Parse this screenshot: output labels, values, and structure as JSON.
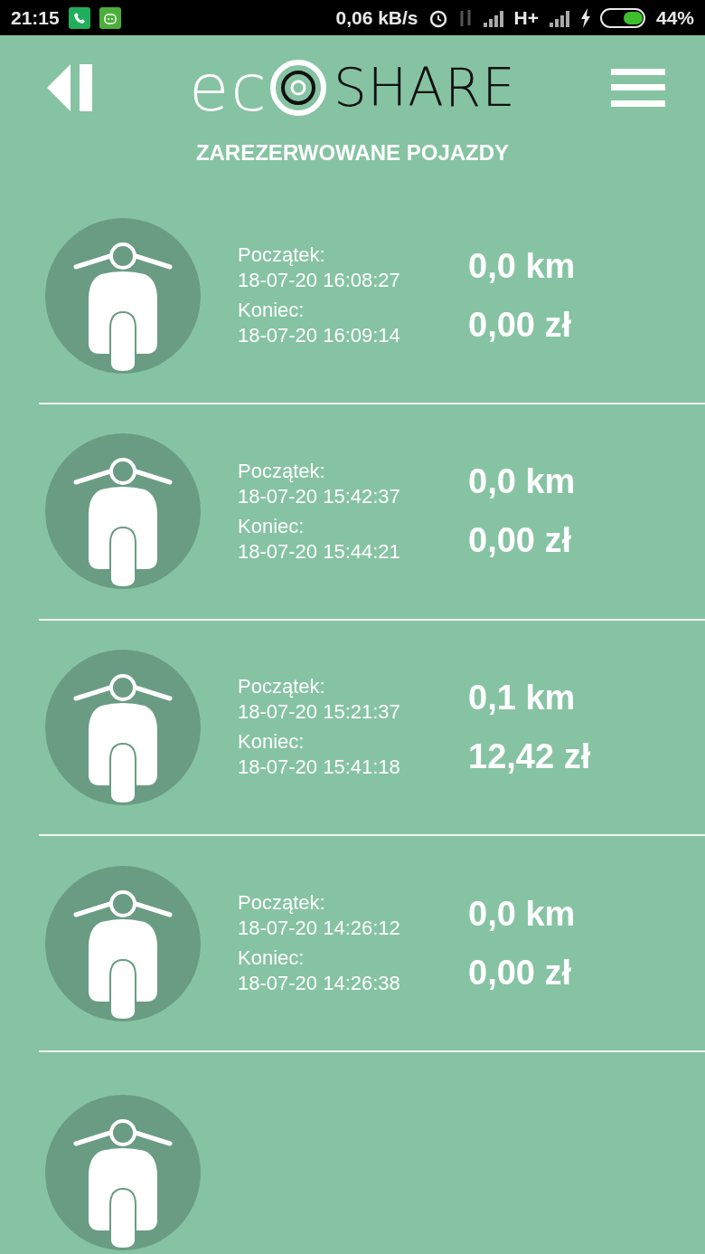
{
  "status_bar": {
    "time": "21:15",
    "speed": "0,06 kB/s",
    "network": "H+",
    "battery": "44%"
  },
  "header": {
    "logo_left": "ec",
    "logo_right": "SHARE",
    "title": "ZAREZERWOWANE POJAZDY"
  },
  "rides": [
    {
      "start_label": "Początek:",
      "start": "18-07-20 16:08:27",
      "end_label": "Koniec:",
      "end": "18-07-20 16:09:14",
      "distance": "0,0 km",
      "cost": "0,00 zł"
    },
    {
      "start_label": "Początek:",
      "start": "18-07-20 15:42:37",
      "end_label": "Koniec:",
      "end": "18-07-20 15:44:21",
      "distance": "0,0 km",
      "cost": "0,00 zł"
    },
    {
      "start_label": "Początek:",
      "start": "18-07-20 15:21:37",
      "end_label": "Koniec:",
      "end": "18-07-20 15:41:18",
      "distance": "0,1 km",
      "cost": "12,42 zł"
    },
    {
      "start_label": "Początek:",
      "start": "18-07-20 14:26:12",
      "end_label": "Koniec:",
      "end": "18-07-20 14:26:38",
      "distance": "0,0 km",
      "cost": "0,00 zł"
    }
  ]
}
